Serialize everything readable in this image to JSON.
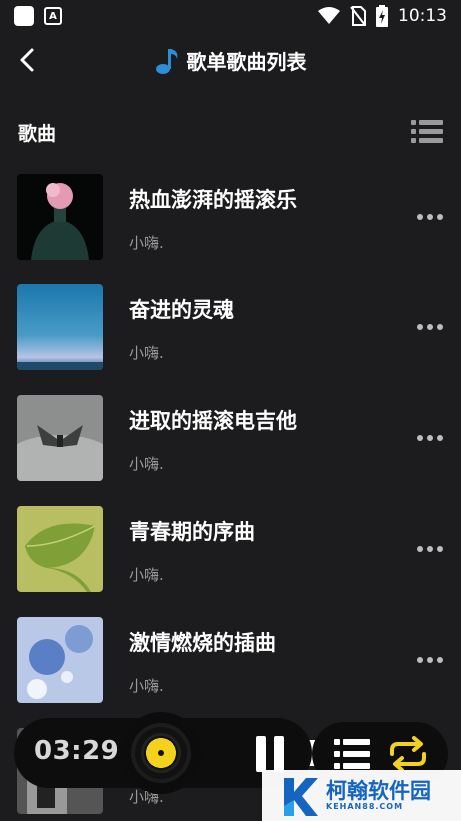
{
  "status_bar": {
    "time": "10:13",
    "icons": [
      "notification-square-icon",
      "a-badge-icon",
      "wifi-icon",
      "no-sim-icon",
      "battery-charging-icon"
    ]
  },
  "header": {
    "title": "歌单歌曲列表",
    "title_icon": "music-note-icon",
    "back_icon": "back-chevron-icon"
  },
  "section": {
    "label": "歌曲",
    "toggle_icon": "list-icon"
  },
  "songs": [
    {
      "title": "热血澎湃的摇滚乐",
      "artist": "小嗨."
    },
    {
      "title": "奋进的灵魂",
      "artist": "小嗨."
    },
    {
      "title": "进取的摇滚电吉他",
      "artist": "小嗨."
    },
    {
      "title": "青春期的序曲",
      "artist": "小嗨."
    },
    {
      "title": "激情燃烧的插曲",
      "artist": "小嗨."
    },
    {
      "title": "",
      "artist": "小嗨."
    }
  ],
  "player": {
    "time": "03:29",
    "state": "playing"
  },
  "controls": {
    "playlist_icon": "playlist-icon",
    "repeat_icon": "repeat-icon",
    "accent_color": "#f2d11f"
  },
  "watermark": {
    "main": "柯翰软件园",
    "sub": "KEHAN88.COM"
  }
}
